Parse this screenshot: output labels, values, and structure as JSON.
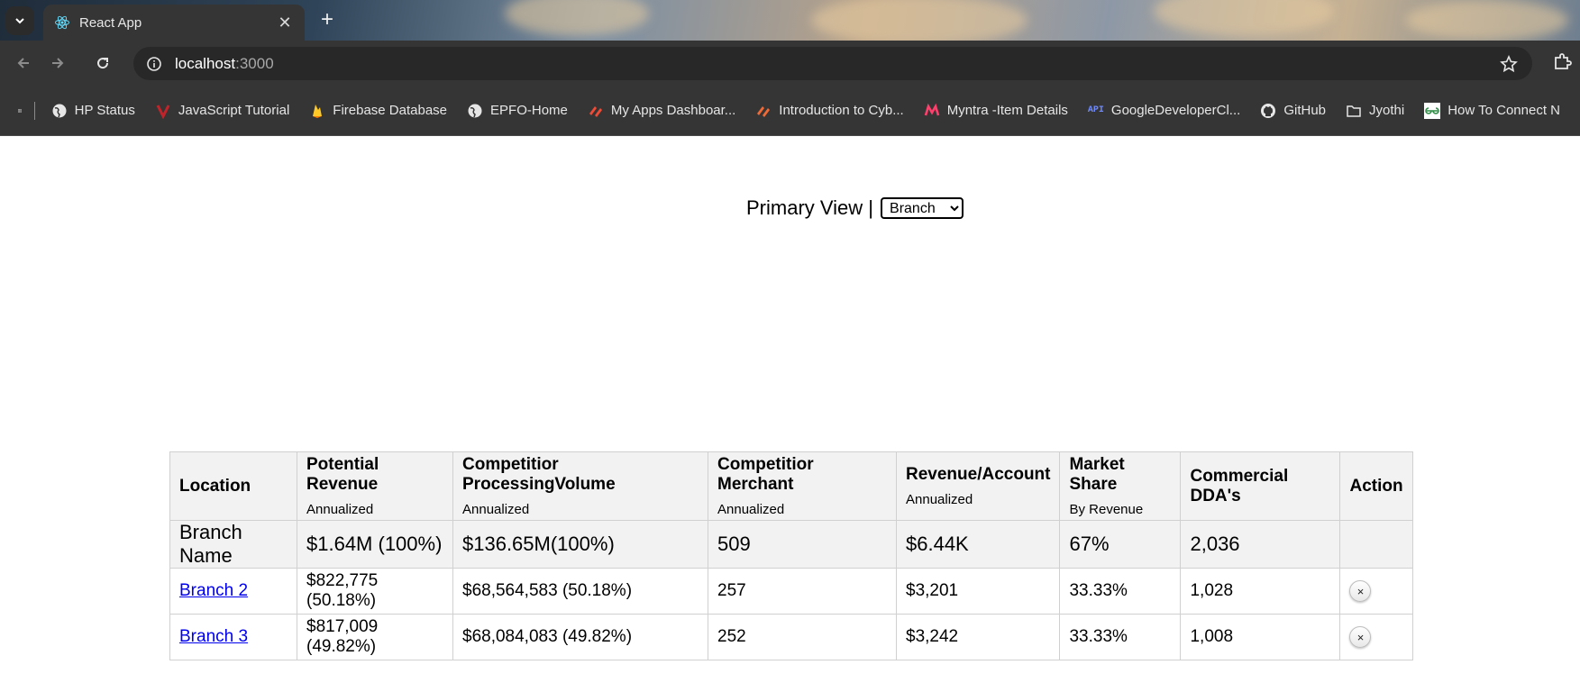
{
  "browser": {
    "tab_title": "React App",
    "url_host": "localhost",
    "url_port": ":3000",
    "bookmarks": [
      {
        "label": "HP Status",
        "icon": "globe-icon"
      },
      {
        "label": "JavaScript Tutorial",
        "icon": "w3schools-icon"
      },
      {
        "label": "Firebase Database",
        "icon": "firebase-icon"
      },
      {
        "label": "EPFO-Home",
        "icon": "globe-icon"
      },
      {
        "label": "My Apps Dashboar...",
        "icon": "app-dashboard-icon"
      },
      {
        "label": "Introduction to Cyb...",
        "icon": "course-icon"
      },
      {
        "label": "Myntra -Item Details",
        "icon": "myntra-icon"
      },
      {
        "label": "GoogleDeveloperCl...",
        "icon": "api-icon"
      },
      {
        "label": "GitHub",
        "icon": "github-icon"
      },
      {
        "label": "Jyothi",
        "icon": "folder-icon"
      },
      {
        "label": "How To Connect N",
        "icon": "gfg-icon"
      }
    ]
  },
  "page": {
    "primary_view_label": "Primary View |",
    "view_select": {
      "selected": "Branch",
      "options": [
        "Branch"
      ]
    }
  },
  "table": {
    "headers": [
      {
        "title": "Location",
        "sub": ""
      },
      {
        "title": "Potential Revenue",
        "sub": "Annualized"
      },
      {
        "title": "Competitior ProcessingVolume",
        "sub": "Annualized"
      },
      {
        "title": "Competitior Merchant",
        "sub": "Annualized"
      },
      {
        "title": "Revenue/Account",
        "sub": "Annualized"
      },
      {
        "title": "Market Share",
        "sub": "By Revenue"
      },
      {
        "title": "Commercial DDA's",
        "sub": ""
      },
      {
        "title": "Action",
        "sub": ""
      }
    ],
    "total": {
      "location": "Branch Name",
      "potential_revenue": "$1.64M (100%)",
      "processing_volume": "$136.65M(100%)",
      "merchant": "509",
      "revenue_account": "$6.44K",
      "market_share": "67%",
      "dda": "2,036"
    },
    "rows": [
      {
        "location": "Branch 2",
        "potential_revenue": "$822,775 (50.18%)",
        "processing_volume": "$68,564,583 (50.18%)",
        "merchant": "257",
        "revenue_account": "$3,201",
        "market_share": "33.33%",
        "dda": "1,028",
        "action": "×"
      },
      {
        "location": "Branch 3",
        "potential_revenue": "$817,009 (49.82%)",
        "processing_volume": "$68,084,083 (49.82%)",
        "merchant": "252",
        "revenue_account": "$3,242",
        "market_share": "33.33%",
        "dda": "1,008",
        "action": "×"
      }
    ]
  }
}
